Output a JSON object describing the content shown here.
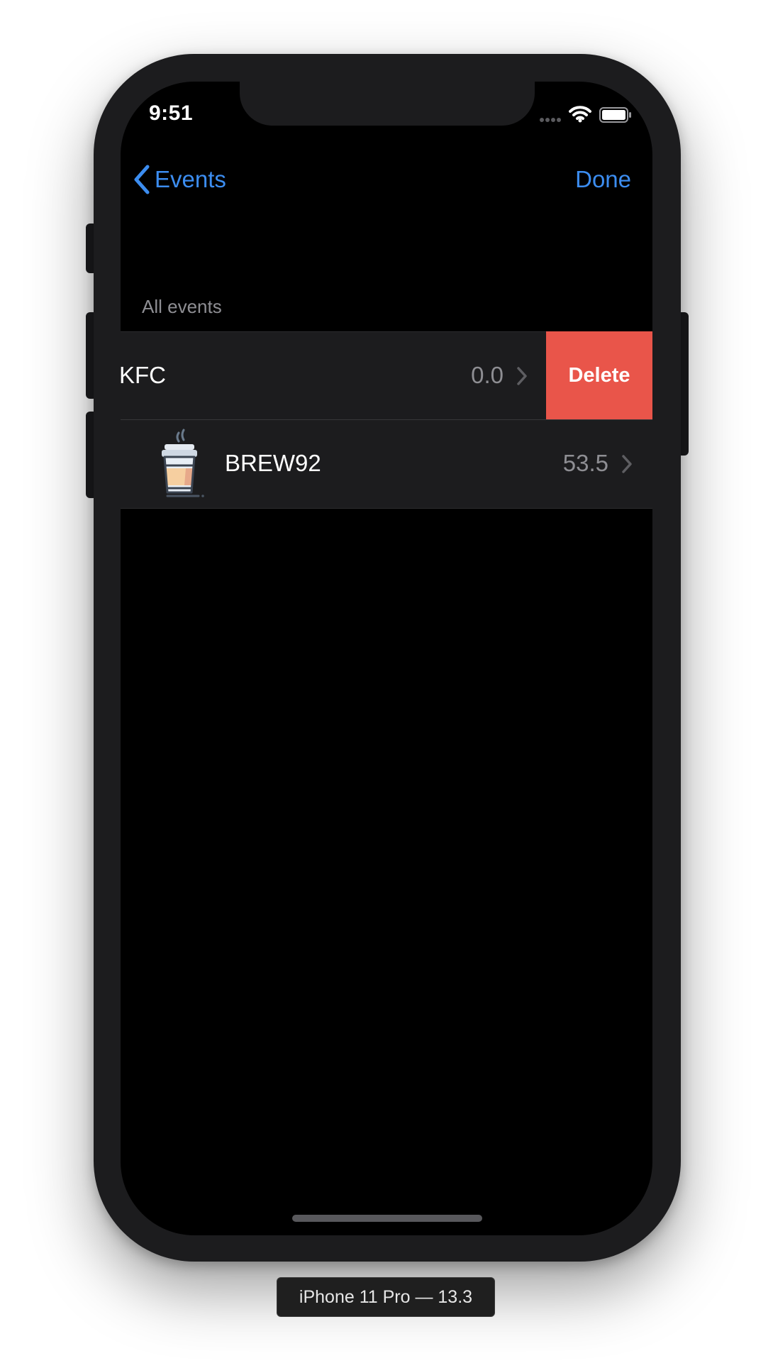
{
  "status_bar": {
    "time": "9:51",
    "icons": [
      "cellular-signal-icon",
      "wifi-icon",
      "battery-icon"
    ]
  },
  "nav": {
    "back_label": "Events",
    "done_label": "Done"
  },
  "section": {
    "header": "All events"
  },
  "rows": [
    {
      "title": "KFC",
      "value": "0.0",
      "swiped": true,
      "action_label": "Delete"
    },
    {
      "title": "BREW92",
      "value": "53.5",
      "icon": "coffee-cup-icon"
    }
  ],
  "device_caption": "iPhone 11 Pro — 13.3",
  "colors": {
    "accent": "#3c8df0",
    "delete": "#e9554a",
    "cell_background": "#1c1c1e",
    "screen_background": "#000000",
    "secondary_text": "#8e8e93"
  }
}
